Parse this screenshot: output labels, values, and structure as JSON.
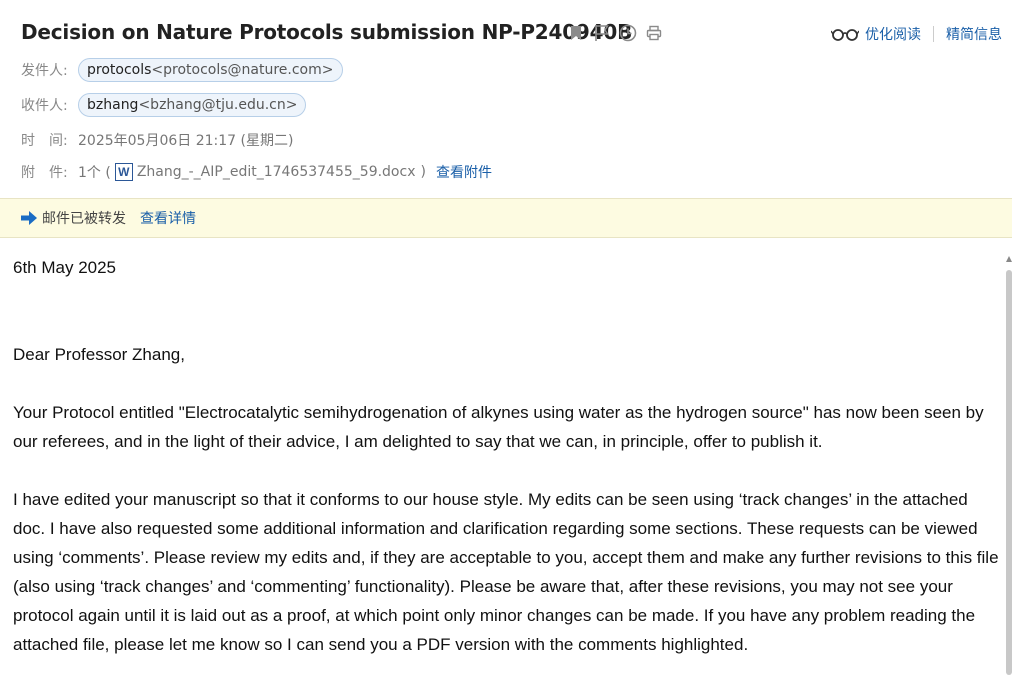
{
  "subject": "Decision on Nature Protocols submission NP-P240940B",
  "subject_icons": [
    "bookmark-icon",
    "flag-icon",
    "clock-icon",
    "print-icon"
  ],
  "toolbar": {
    "optimize_read_label": "优化阅读",
    "summary_label": "精简信息"
  },
  "meta": {
    "from_label": "发件人:",
    "from_name": "protocols",
    "from_addr": "<protocols@nature.com>",
    "to_label": "收件人:",
    "to_name": "bzhang",
    "to_addr": "<bzhang@tju.edu.cn>",
    "time_label": "时　间:",
    "time_value": "2025年05月06日 21:17 (星期二)",
    "attach_label": "附　件:",
    "attach_count": "1个 (",
    "attach_file": "Zhang_-_AIP_edit_1746537455_59.docx",
    "attach_close": ")",
    "attach_view": "查看附件"
  },
  "forward_bar": {
    "text": "邮件已被转发",
    "detail": "查看详情"
  },
  "body": {
    "date": "6th May 2025",
    "greeting": "Dear Professor Zhang,",
    "para1": "Your Protocol entitled \"Electrocatalytic semihydrogenation of alkynes using water as the hydrogen source\" has now been seen by our referees, and in the light of their advice, I am delighted to say that we can, in principle, offer to publish it.",
    "para2": "I have edited your manuscript so that it conforms to our house style. My edits can be seen using ‘track changes’ in the attached doc. I have also requested some additional information and clarification regarding some sections. These requests can be viewed using ‘comments’. Please review my edits and, if they are acceptable to you, accept them and make any further revisions to this file (also using ‘track changes’ and ‘commenting’ functionality). Please be aware that, after these revisions, you may not see your protocol again until it is laid out as a proof, at which point only minor changes can be made. If you have any problem reading the attached file, please let me know so I can send you a PDF version with the comments highlighted."
  }
}
